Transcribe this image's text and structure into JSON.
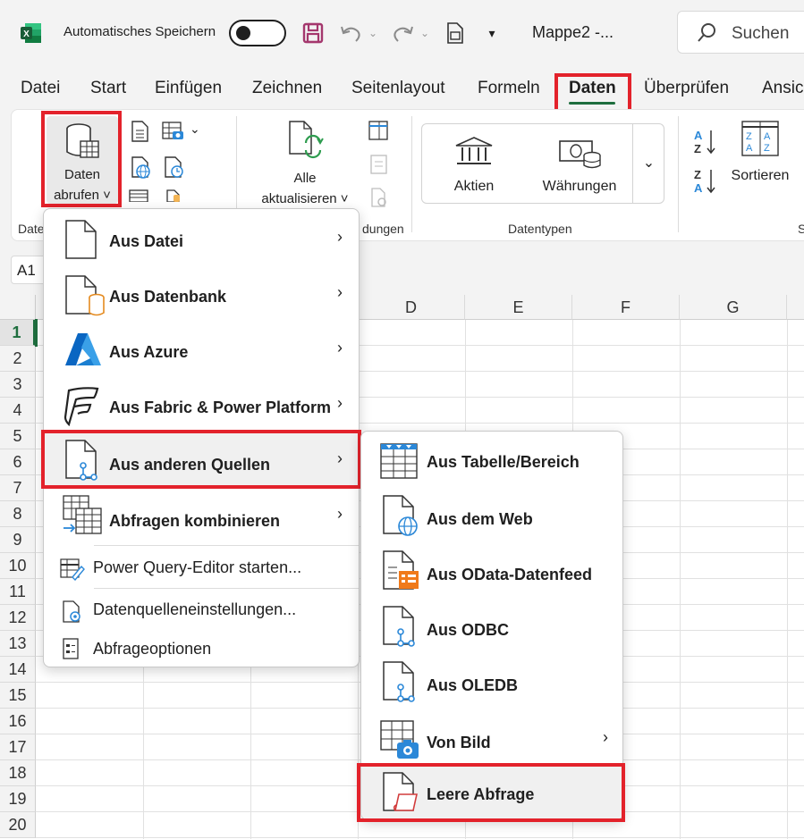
{
  "titlebar": {
    "autosave_label": "Automatisches Speichern",
    "doc_title": "Mappe2  -...",
    "search_placeholder": "Suchen"
  },
  "tabs": [
    "Datei",
    "Start",
    "Einfügen",
    "Zeichnen",
    "Seitenlayout",
    "Formeln",
    "Daten",
    "Überprüfen",
    "Ansic"
  ],
  "active_tab": "Daten",
  "ribbon": {
    "get_data_label_line1": "Daten",
    "get_data_label_line2": "abrufen ˅",
    "refresh_line1": "Alle",
    "refresh_line2": "aktualisieren ˅",
    "stocks": "Aktien",
    "currencies": "Währungen",
    "sort": "Sortieren",
    "group_get": "Date",
    "group_queries": "dungen",
    "group_datatypes": "Datentypen",
    "group_sort": "S"
  },
  "namebox": "A1",
  "columns": [
    "D",
    "E",
    "F",
    "G"
  ],
  "rows": [
    "1",
    "2",
    "3",
    "4",
    "5",
    "6",
    "7",
    "8",
    "9",
    "10",
    "11",
    "12",
    "13",
    "14",
    "15",
    "16",
    "17",
    "18",
    "19",
    "20"
  ],
  "main_menu": {
    "items": [
      {
        "label": "Aus Datei",
        "icon": "file-icon"
      },
      {
        "label": "Aus Datenbank",
        "icon": "database-file-icon"
      },
      {
        "label": "Aus Azure",
        "icon": "azure-icon"
      },
      {
        "label": "Aus Fabric & Power Platform",
        "icon": "fabric-icon"
      },
      {
        "label": "Aus anderen Quellen",
        "icon": "other-sources-icon"
      },
      {
        "label": "Abfragen kombinieren",
        "icon": "combine-queries-icon"
      }
    ],
    "plain_items": [
      {
        "label": "Power Query-Editor starten...",
        "icon": "power-query-editor-icon"
      },
      {
        "label": "Datenquelleneinstellungen...",
        "icon": "data-source-settings-icon"
      },
      {
        "label": "Abfrageoptionen",
        "icon": "query-options-icon"
      }
    ]
  },
  "sub_menu": {
    "items": [
      {
        "label": "Aus Tabelle/Bereich",
        "icon": "table-range-icon"
      },
      {
        "label": "Aus dem Web",
        "icon": "web-icon"
      },
      {
        "label": "Aus OData-Datenfeed",
        "icon": "odata-icon"
      },
      {
        "label": "Aus ODBC",
        "icon": "odbc-icon"
      },
      {
        "label": "Aus OLEDB",
        "icon": "oledb-icon"
      },
      {
        "label": "Von Bild",
        "icon": "from-picture-icon"
      },
      {
        "label": "Leere Abfrage",
        "icon": "blank-query-icon"
      }
    ]
  },
  "colors": {
    "accent": "#1e6e3e",
    "highlight_box": "#e3222b",
    "save_icon": "#a4376d"
  }
}
